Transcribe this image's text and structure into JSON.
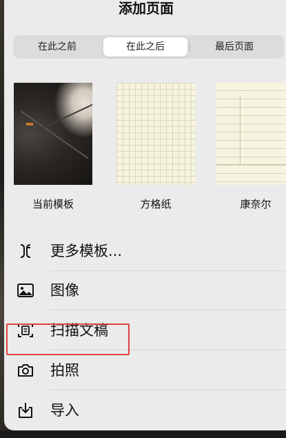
{
  "sheet": {
    "title": "添加页面"
  },
  "segments": [
    {
      "label": "在此之前",
      "selected": false
    },
    {
      "label": "在此之后",
      "selected": true
    },
    {
      "label": "最后页面",
      "selected": false
    }
  ],
  "templates": [
    {
      "label": "当前模板",
      "thumbnail": "photo"
    },
    {
      "label": "方格纸",
      "thumbnail": "grid-paper"
    },
    {
      "label": "康奈尔",
      "thumbnail": "cornell-notes"
    }
  ],
  "menu": [
    {
      "label": "更多模板...",
      "icon": "templates-icon"
    },
    {
      "label": "图像",
      "icon": "image-icon"
    },
    {
      "label": "扫描文稿",
      "icon": "scan-document-icon",
      "highlighted": true
    },
    {
      "label": "拍照",
      "icon": "camera-icon"
    },
    {
      "label": "导入",
      "icon": "import-icon"
    }
  ],
  "colors": {
    "sheet_bg": "#ebebeb",
    "highlight": "#e04040",
    "segment_bg": "#dcdcdc"
  }
}
